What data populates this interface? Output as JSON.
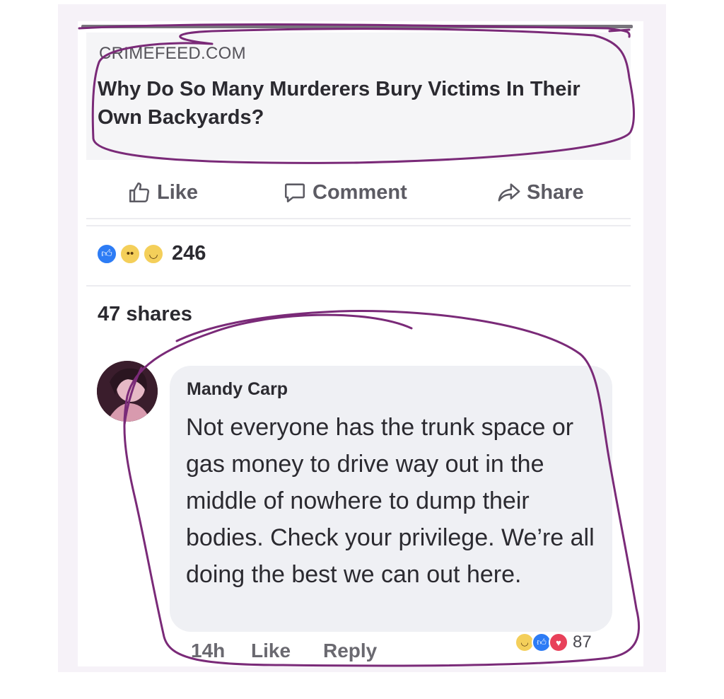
{
  "post": {
    "link": {
      "source": "CRIMEFEED.COM",
      "headline": "Why Do So Many Murderers Bury Victims In Their Own Backyards?"
    },
    "actions": [
      {
        "label": "Like",
        "icon": "thumbs-up-icon"
      },
      {
        "label": "Comment",
        "icon": "speech-bubble-icon"
      },
      {
        "label": "Share",
        "icon": "share-arrow-icon"
      }
    ],
    "reactions": {
      "icons": [
        "like-reaction-icon",
        "wow-reaction-icon",
        "haha-reaction-icon"
      ],
      "count": "246"
    },
    "shares": "47 shares"
  },
  "comment": {
    "author": "Mandy Carp",
    "text": "Not everyone has the trunk space or gas money to drive way out in the middle of nowhere to dump their bodies. Check your privilege. We’re all doing the best we can out here.",
    "time": "14h",
    "like_label": "Like",
    "reply_label": "Reply",
    "reactions": {
      "icons": [
        "haha-reaction-icon",
        "like-reaction-icon",
        "love-reaction-icon"
      ],
      "count": "87"
    }
  },
  "colors": {
    "annotation": "#7a2a78",
    "like_blue": "#2d7cf5",
    "love_red": "#e8415a",
    "emoji_yellow": "#f4cf5a"
  }
}
